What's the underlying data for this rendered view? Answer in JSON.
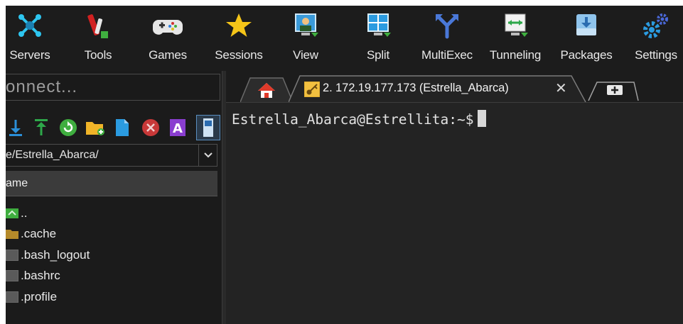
{
  "toolbar": {
    "items": [
      {
        "label": "Servers",
        "icon": "servers-icon"
      },
      {
        "label": "Tools",
        "icon": "tools-icon"
      },
      {
        "label": "Games",
        "icon": "games-icon"
      },
      {
        "label": "Sessions",
        "icon": "sessions-icon"
      },
      {
        "label": "View",
        "icon": "view-icon"
      },
      {
        "label": "Split",
        "icon": "split-icon"
      },
      {
        "label": "MultiExec",
        "icon": "multiexec-icon"
      },
      {
        "label": "Tunneling",
        "icon": "tunneling-icon"
      },
      {
        "label": "Packages",
        "icon": "packages-icon"
      },
      {
        "label": "Settings",
        "icon": "settings-icon"
      }
    ]
  },
  "sidebar": {
    "quick_connect_placeholder": "onnect...",
    "path": "e/Estrella_Abarca/",
    "column_header": "ame",
    "files": [
      {
        "name": "..",
        "icon": "parent-folder-icon"
      },
      {
        "name": ".cache",
        "icon": "folder-icon"
      },
      {
        "name": ".bash_logout",
        "icon": "file-icon"
      },
      {
        "name": ".bashrc",
        "icon": "file-icon"
      },
      {
        "name": ".profile",
        "icon": "file-icon"
      }
    ]
  },
  "tabs": {
    "session_title": "2. 172.19.177.173 (Estrella_Abarca)",
    "close_symbol": "✕"
  },
  "terminal": {
    "prompt": "Estrella_Abarca@Estrellita:~$"
  },
  "colors": {
    "toolbar_bg": "#1c1c1c",
    "terminal_bg": "#232323",
    "text": "#e8e8e8",
    "accent_green": "#3fae3f",
    "accent_blue": "#2b9be0"
  }
}
